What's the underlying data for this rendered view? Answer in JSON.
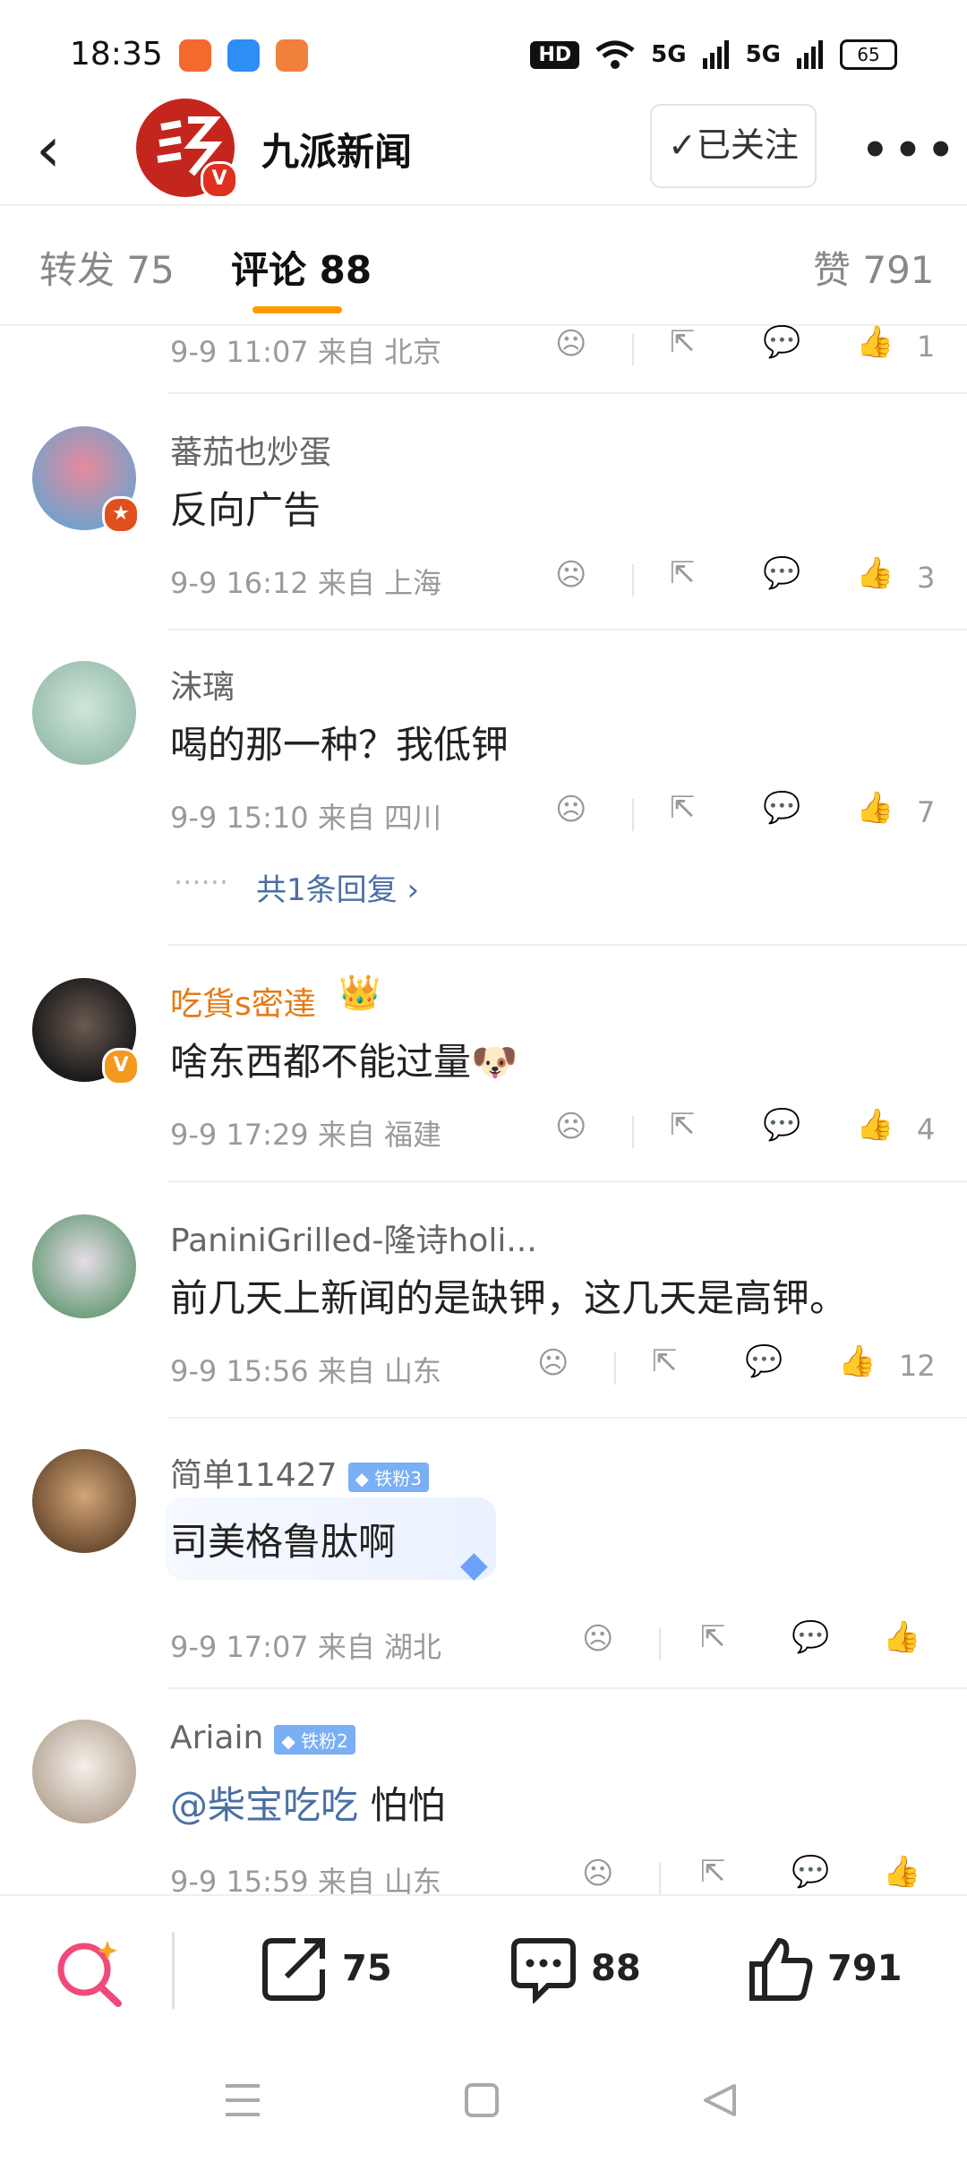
{
  "status": {
    "time": "18:35",
    "hd": "HD",
    "net1": "5G",
    "net2": "5G",
    "battery": "65"
  },
  "header": {
    "title": "九派新闻",
    "follow_label": "✓已关注",
    "back_icon": "chevron-left-icon",
    "more_icon": "more-icon"
  },
  "tabs": {
    "repost": "转发 75",
    "comments": "评论 88",
    "likes": "赞 791"
  },
  "comments": [
    {
      "meta": "9-9 11:07 来自 北京",
      "likes": "1"
    },
    {
      "name": "蕃茄也炒蛋",
      "text": "反向广告",
      "meta": "9-9 16:12 来自 上海",
      "likes": "3"
    },
    {
      "name": "沫璃",
      "text": "喝的那一种？我低钾",
      "meta": "9-9 15:10 来自 四川",
      "likes": "7",
      "replies": "共1条回复",
      "replies_prefix": "······"
    },
    {
      "name": "吃貨s密達",
      "text": "啥东西都不能过量",
      "meta": "9-9 17:29 来自 福建",
      "likes": "4"
    },
    {
      "name": "PaniniGrilled-隆诗holi...",
      "text": "前几天上新闻的是缺钾，这几天是高钾。",
      "meta": "9-9 15:56 来自 山东",
      "likes": "12"
    },
    {
      "name": "简单11427",
      "badge": "铁粉3",
      "text": "司美格鲁肽啊",
      "meta": "9-9 17:07 来自 湖北",
      "likes": ""
    },
    {
      "name": "Ariain",
      "badge": "铁粉2",
      "mention": "@柴宝吃吃",
      "text": " 怕怕",
      "meta": "9-9 15:59 来自 山东",
      "likes": ""
    }
  ],
  "bottom": {
    "reposts": "75",
    "comments": "88",
    "likes": "791"
  },
  "colors": {
    "accent": "#ff9a00",
    "brand": "#c4261d",
    "link": "#4a6fa5",
    "gold_name": "#e57a14",
    "fan_badge": "#7aaef5"
  }
}
